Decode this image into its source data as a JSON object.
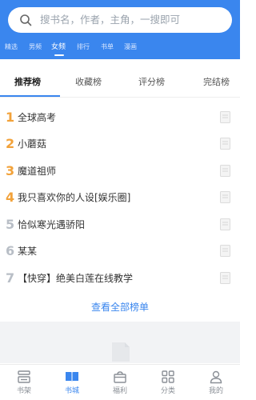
{
  "search": {
    "placeholder": "搜书名，作者，主角，一搜即可"
  },
  "category_tabs": [
    {
      "label": "精选",
      "active": false
    },
    {
      "label": "男频",
      "active": false
    },
    {
      "label": "女频",
      "active": true
    },
    {
      "label": "排行",
      "active": false
    },
    {
      "label": "书单",
      "active": false
    },
    {
      "label": "漫画",
      "active": false
    }
  ],
  "rank_tabs": [
    {
      "label": "推荐榜",
      "active": true
    },
    {
      "label": "收藏榜",
      "active": false
    },
    {
      "label": "评分榜",
      "active": false
    },
    {
      "label": "完结榜",
      "active": false
    }
  ],
  "books": [
    {
      "rank": "1",
      "title": "全球高考"
    },
    {
      "rank": "2",
      "title": "小蘑菇"
    },
    {
      "rank": "3",
      "title": "魔道祖师"
    },
    {
      "rank": "4",
      "title": "我只喜欢你的人设[娱乐圈]"
    },
    {
      "rank": "5",
      "title": "恰似寒光遇骄阳"
    },
    {
      "rank": "6",
      "title": "某某"
    },
    {
      "rank": "7",
      "title": "【快穿】绝美白莲在线教学"
    }
  ],
  "view_all_label": "查看全部榜单",
  "tabbar": [
    {
      "label": "书架",
      "icon": "bookshelf-icon",
      "active": false
    },
    {
      "label": "书城",
      "icon": "open-book-icon",
      "active": true
    },
    {
      "label": "福利",
      "icon": "gift-icon",
      "active": false
    },
    {
      "label": "分类",
      "icon": "category-grid-icon",
      "active": false
    },
    {
      "label": "我的",
      "icon": "profile-icon",
      "active": false
    }
  ],
  "colors": {
    "accent": "#3a86ee",
    "rank_top": "#f2a23a",
    "rank_rest": "#b8bec6"
  }
}
